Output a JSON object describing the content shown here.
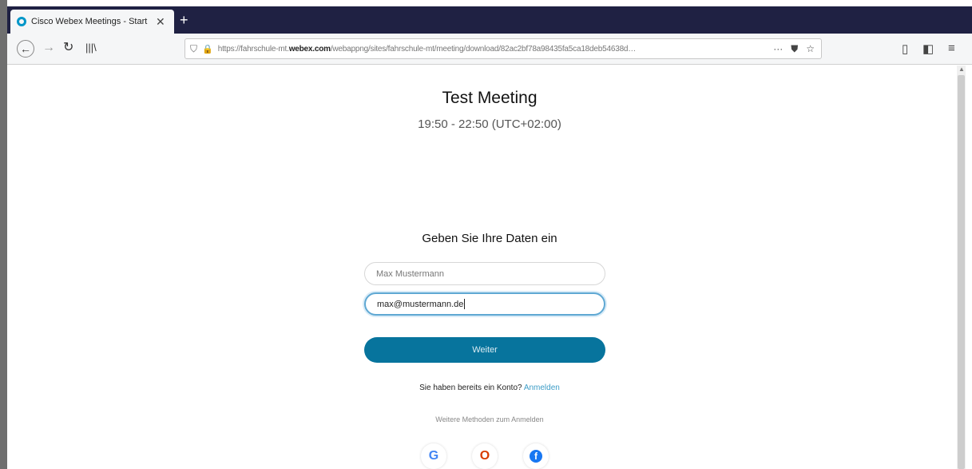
{
  "browser": {
    "tab_title": "Cisco Webex Meetings - Start",
    "tab_close": "✕",
    "new_tab": "+",
    "url_prefix": "https://fahrschule-mt.",
    "url_domain": "webex.com",
    "url_rest": "/webappng/sites/fahrschule-mt/meeting/download/82ac2bf78a98435fa5ca18deb54638d…",
    "url_more": "···"
  },
  "meeting": {
    "title": "Test Meeting",
    "time": "19:50 - 22:50 (UTC+02:00)"
  },
  "form": {
    "heading": "Geben Sie Ihre Daten ein",
    "name_placeholder": "Max Mustermann",
    "email_value": "max@mustermann.de",
    "submit_label": "Weiter",
    "account_text": "Sie haben bereits ein Konto?",
    "signin_link": "Anmelden",
    "other_methods": "Weitere Methoden zum Anmelden"
  },
  "social": [
    {
      "name": "google-icon",
      "glyph": "G"
    },
    {
      "name": "office-icon",
      "glyph": "O"
    },
    {
      "name": "facebook-icon",
      "glyph": "f"
    }
  ],
  "colors": {
    "accent": "#07749d",
    "link": "#3d9dc7",
    "tabbar": "#1f2143"
  }
}
